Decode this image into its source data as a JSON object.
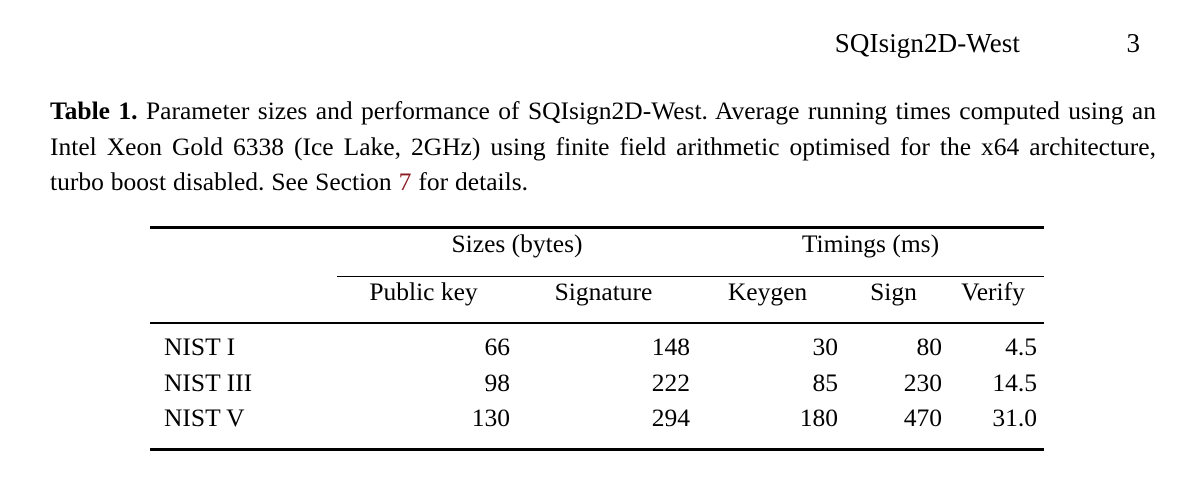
{
  "header": {
    "title": "SQIsign2D-West",
    "page_number": "3"
  },
  "caption": {
    "label": "Table 1.",
    "text_part_1": " Parameter sizes and performance of SQIsign2D-West. Average running times computed using an Intel Xeon Gold 6338 (Ice Lake, 2GHz) using finite field arithmetic optimised for the x64 architecture, turbo boost disabled. See Section ",
    "xref": "7",
    "text_part_2": " for details.",
    "xref_color": "#8c1b22"
  },
  "table": {
    "group_headers": [
      {
        "label": "",
        "span": 1
      },
      {
        "label": "Sizes (bytes)",
        "span": 2
      },
      {
        "label": "Timings (ms)",
        "span": 3
      }
    ],
    "group_sizes": "Sizes (bytes)",
    "group_timings": "Timings (ms)",
    "columns": [
      "",
      "Public key",
      "Signature",
      "Keygen",
      "Sign",
      "Verify"
    ],
    "rows": [
      {
        "scheme": "NIST I",
        "public_key": "66",
        "signature": "148",
        "keygen": "30",
        "sign": "80",
        "verify": "4.5"
      },
      {
        "scheme": "NIST III",
        "public_key": "98",
        "signature": "222",
        "keygen": "85",
        "sign": "230",
        "verify": "14.5"
      },
      {
        "scheme": "NIST V",
        "public_key": "130",
        "signature": "294",
        "keygen": "180",
        "sign": "470",
        "verify": "31.0"
      }
    ]
  }
}
